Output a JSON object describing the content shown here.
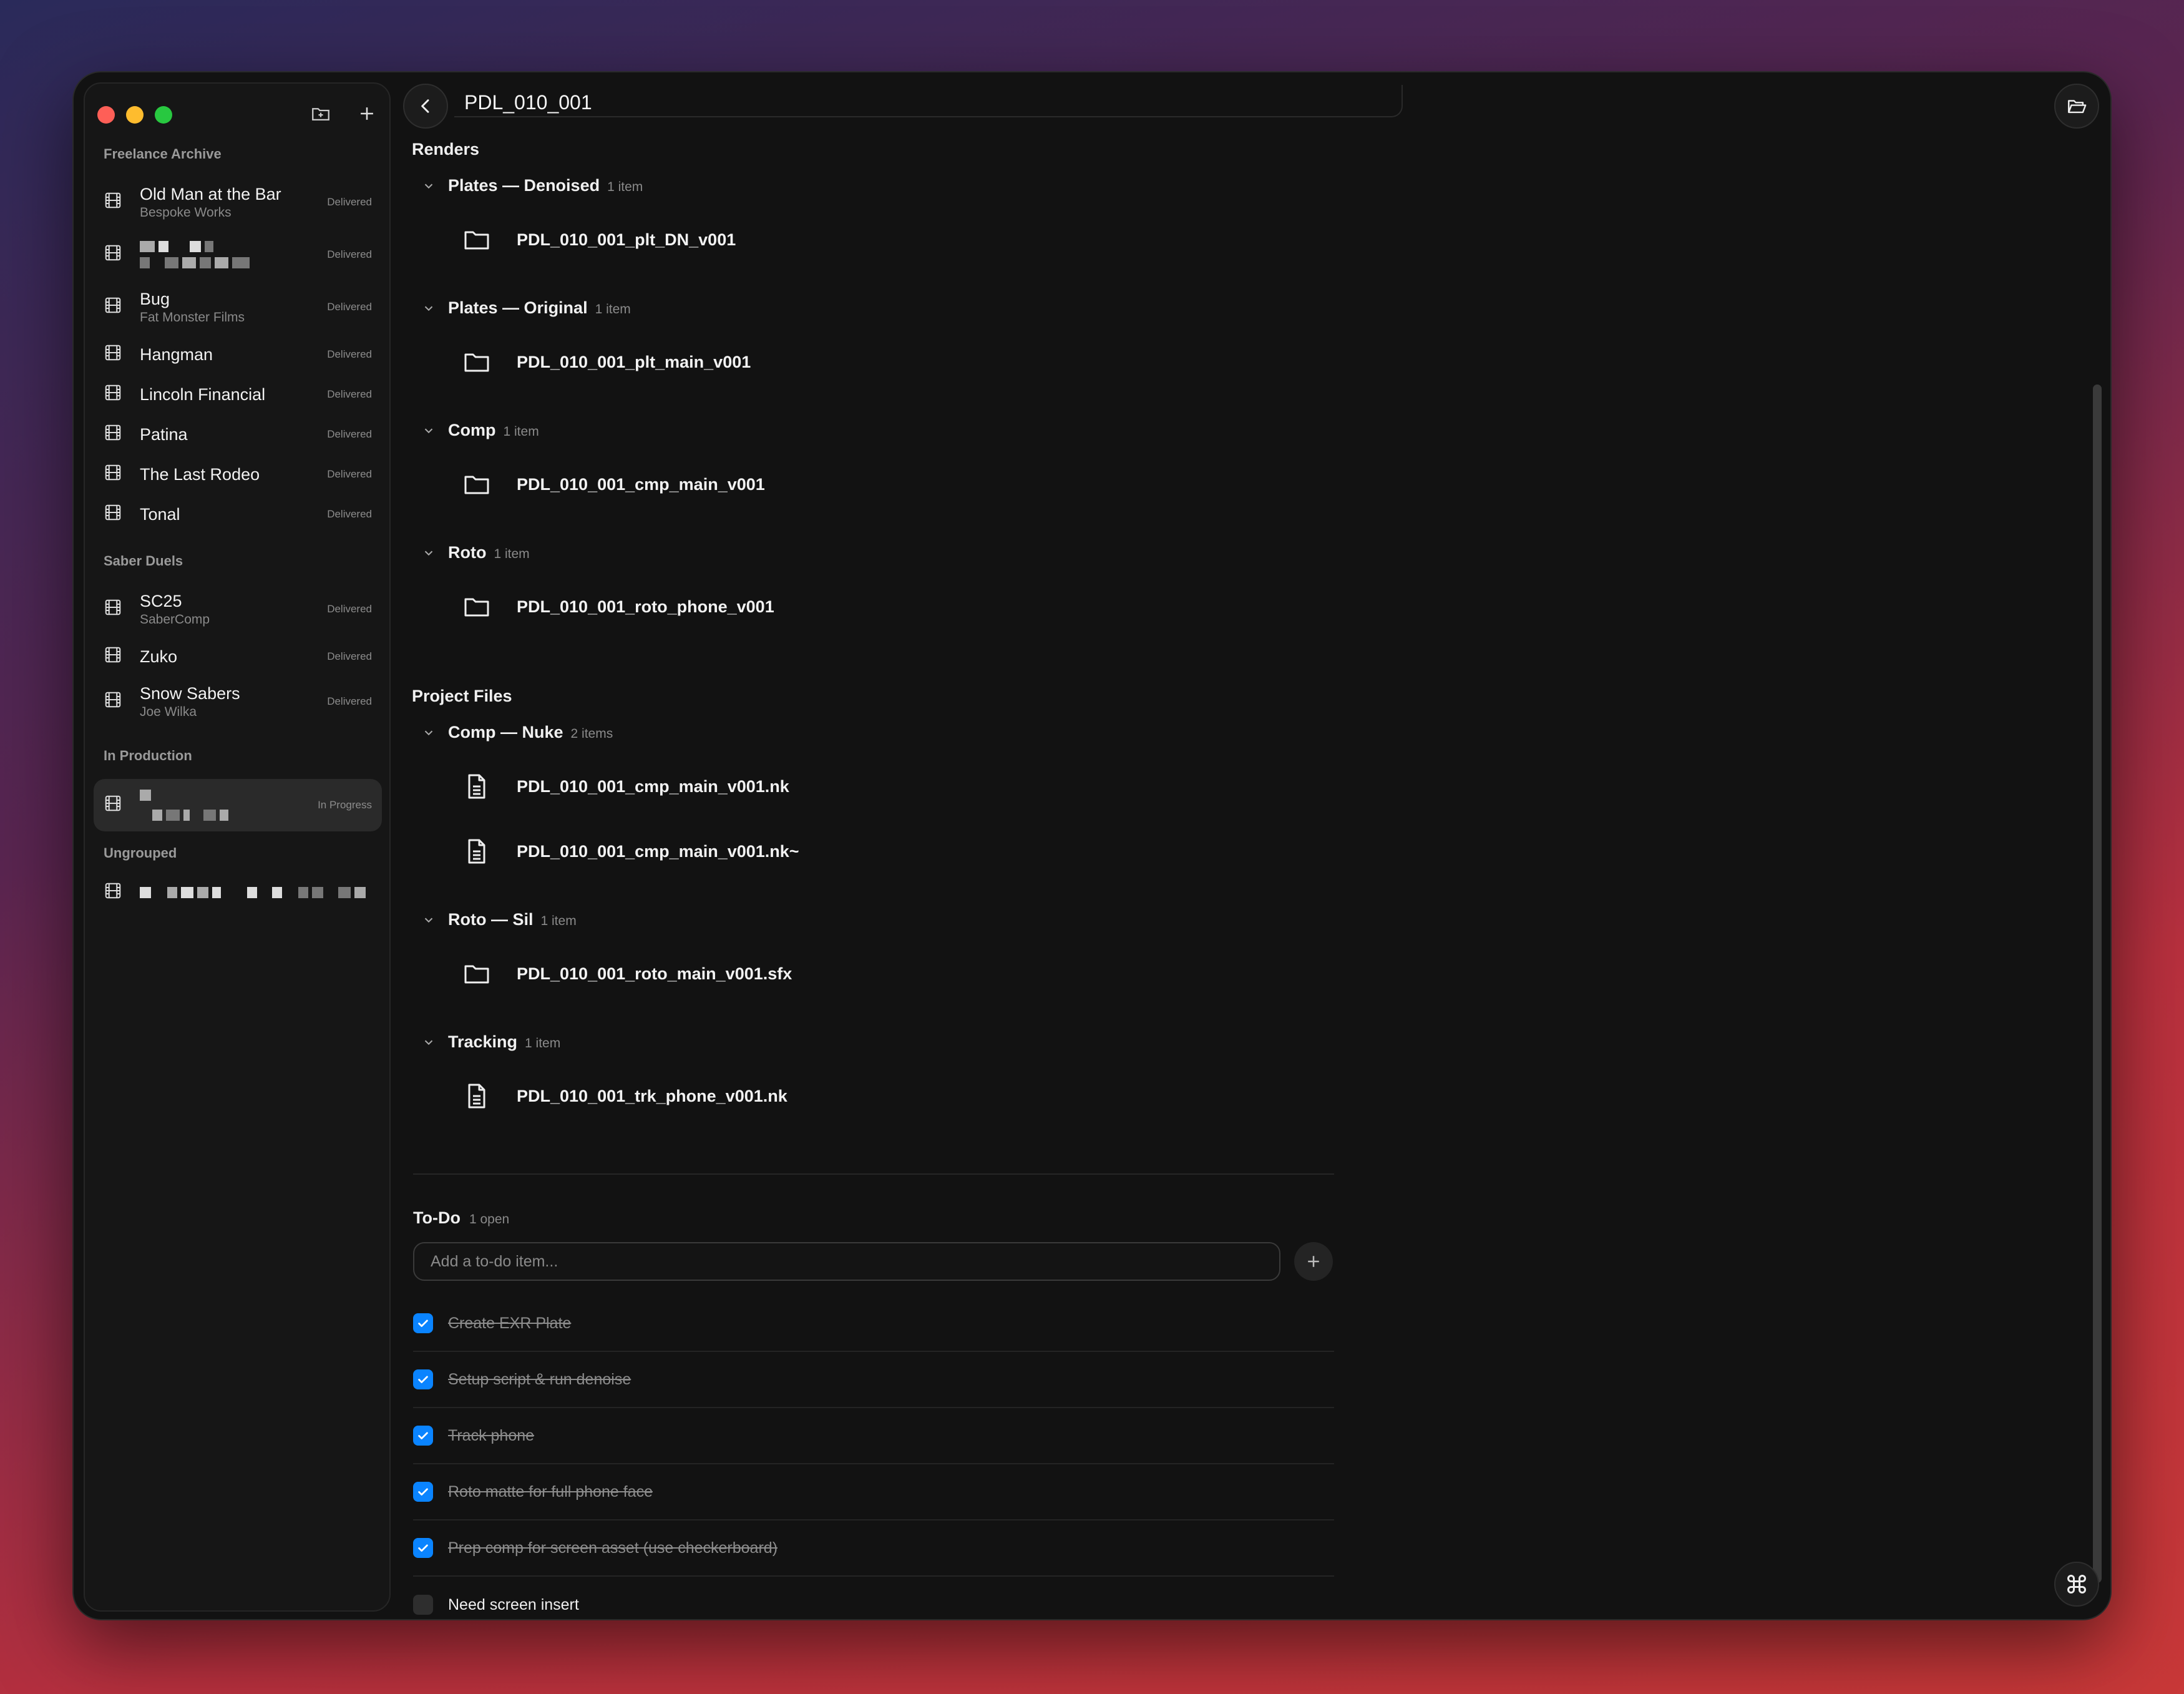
{
  "header": {
    "title": "PDL_010_001"
  },
  "sidebar": {
    "groups": [
      {
        "label": "Freelance Archive"
      },
      {
        "label": "Saber Duels"
      },
      {
        "label": "In Production"
      },
      {
        "label": "Ungrouped"
      }
    ],
    "items": [
      {
        "title": "Old Man at the Bar",
        "sub": "Bespoke Works",
        "badge": "Delivered"
      },
      {
        "title": "",
        "sub": "",
        "badge": "Delivered"
      },
      {
        "title": "Bug",
        "sub": "Fat Monster Films",
        "badge": "Delivered"
      },
      {
        "title": "Hangman",
        "badge": "Delivered"
      },
      {
        "title": "Lincoln Financial",
        "badge": "Delivered"
      },
      {
        "title": "Patina",
        "badge": "Delivered"
      },
      {
        "title": "The Last Rodeo",
        "badge": "Delivered"
      },
      {
        "title": "Tonal",
        "badge": "Delivered"
      },
      {
        "title": "SC25",
        "sub": "SaberComp",
        "badge": "Delivered"
      },
      {
        "title": "Zuko",
        "badge": "Delivered"
      },
      {
        "title": "Snow Sabers",
        "sub": "Joe Wilka",
        "badge": "Delivered"
      },
      {
        "title": "",
        "sub": "",
        "badge": "In Progress"
      },
      {
        "title": "",
        "badge": ""
      }
    ]
  },
  "main": {
    "renders_title": "Renders",
    "project_files_title": "Project Files",
    "renders": [
      {
        "name": "Plates — Denoised",
        "count": "1 item",
        "files": [
          "PDL_010_001_plt_DN_v001"
        ]
      },
      {
        "name": "Plates — Original",
        "count": "1 item",
        "files": [
          "PDL_010_001_plt_main_v001"
        ]
      },
      {
        "name": "Comp",
        "count": "1 item",
        "files": [
          "PDL_010_001_cmp_main_v001"
        ]
      },
      {
        "name": "Roto",
        "count": "1 item",
        "files": [
          "PDL_010_001_roto_phone_v001"
        ]
      }
    ],
    "project_files": [
      {
        "name": "Comp — Nuke",
        "count": "2 items",
        "files": [
          "PDL_010_001_cmp_main_v001.nk",
          "PDL_010_001_cmp_main_v001.nk~"
        ]
      },
      {
        "name": "Roto — Sil",
        "count": "1 item",
        "files": [
          "PDL_010_001_roto_main_v001.sfx"
        ]
      },
      {
        "name": "Tracking",
        "count": "1 item",
        "files": [
          "PDL_010_001_trk_phone_v001.nk"
        ]
      }
    ]
  },
  "todo": {
    "title": "To-Do",
    "count": "1 open",
    "placeholder": "Add a to-do item...",
    "items": [
      {
        "text": "Create EXR Plate",
        "done": true
      },
      {
        "text": "Setup script & run denoise",
        "done": true
      },
      {
        "text": "Track phone",
        "done": true
      },
      {
        "text": "Roto matte for full phone face",
        "done": true
      },
      {
        "text": "Prep comp for screen asset (use checkerboard)",
        "done": true
      },
      {
        "text": "Need screen insert",
        "done": false
      }
    ]
  },
  "colors": {
    "accent": "#0a84ff",
    "window_bg": "#121212",
    "sidebar_bg": "#161616"
  }
}
